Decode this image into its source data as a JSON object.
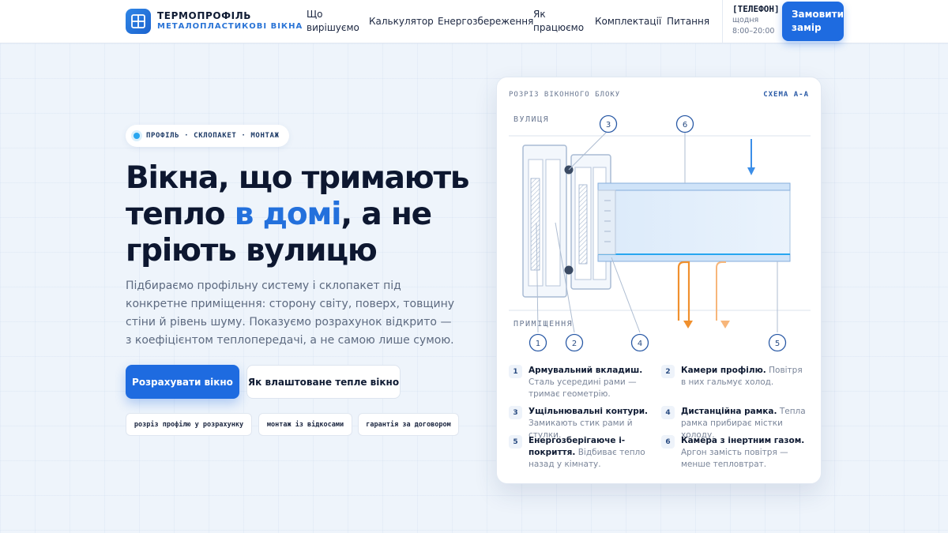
{
  "header": {
    "brand_name": "ТЕРМОПРОФІЛЬ",
    "brand_sub": "МЕТАЛОПЛАСТИКОВІ ВІКНА",
    "nav": [
      "Що вирішуємо",
      "Калькулятор",
      "Енергозбереження",
      "Як працюємо",
      "Комплектації",
      "Питання"
    ],
    "phone": "[ТЕЛЕФОН]",
    "hours_line1": "щодня",
    "hours_line2": "8:00–20:00",
    "cta": "Замовити замір"
  },
  "hero": {
    "pill": "ПРОФІЛЬ · СКЛОПАКЕТ · МОНТАЖ",
    "title_part1": "Вікна, що тримають тепло ",
    "title_accent": "в домі",
    "title_part2": ", а не гріють вулицю",
    "lead": "Підбираємо профільну систему і склопакет під конкретне приміщення: сторону світу, поверх, товщину стіни й рівень шуму. Показуємо розрахунок відкрито — з коефіцієнтом теплопередачі, а не самою лише сумою.",
    "primary_button": "Розрахувати вікно",
    "secondary_button": "Як влаштоване тепле вікно",
    "tags": [
      "розріз профілю у розрахунку",
      "монтаж із відкосами",
      "гарантія за договором"
    ]
  },
  "card": {
    "caption": "РОЗРІЗ ВІКОННОГО БЛОКУ",
    "scheme": "СХЕМА А-А",
    "label_outside": "ВУЛИЦЯ",
    "label_inside": "ПРИМІЩЕННЯ",
    "callouts": [
      "1",
      "2",
      "3",
      "4",
      "5",
      "6"
    ],
    "legend": [
      {
        "num": "1",
        "title": "Армувальний вкладиш.",
        "text": " Сталь усередині рами — тримає геометрію."
      },
      {
        "num": "2",
        "title": "Камери профілю.",
        "text": " Повітря в них гальмує холод."
      },
      {
        "num": "3",
        "title": "Ущільнювальні контури.",
        "text": " Замикають стик рами й стулки."
      },
      {
        "num": "4",
        "title": "Дистанційна рамка.",
        "text": " Тепла рамка прибирає містки холоду."
      },
      {
        "num": "5",
        "title": "Енергозберігаюче і-покриття.",
        "text": " Відбиває тепло назад у кімнату."
      },
      {
        "num": "6",
        "title": "Камера з інертним газом.",
        "text": " Аргон замість повітря — менше тепловтрат."
      }
    ]
  },
  "colors": {
    "accent": "#1e6be0",
    "cold_arrow": "#3b8ee8",
    "heat_arrow": "#f0902e"
  }
}
